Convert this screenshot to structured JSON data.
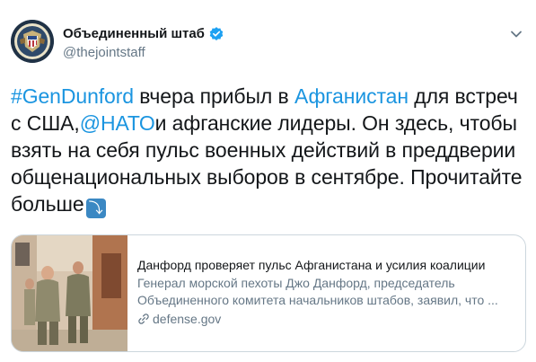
{
  "author": {
    "display_name": "Объединенный штаб",
    "handle": "@thejointstaff",
    "verified_icon": "verified-badge-icon"
  },
  "tweet": {
    "segments": [
      {
        "text": "#GenDunford",
        "type": "hashtag"
      },
      {
        "text": " вчера прибыл в ",
        "type": "text"
      },
      {
        "text": "Афганистан",
        "type": "hashtag"
      },
      {
        "text": " для встреч с США,",
        "type": "text"
      },
      {
        "text": "@НАТО",
        "type": "mention"
      },
      {
        "text": "и афганские лидеры. Он здесь, чтобы взять на себя пульс военных действий в преддверии общенациональных выборов в сентябре. Прочитайте больше",
        "type": "text"
      }
    ],
    "trailing_emoji": "⤵"
  },
  "card": {
    "title": "Данфорд проверяет пульс Афганистана и усилия коалиции",
    "description": "Генерал морской пехоты Джо Данфорд, председатель Объединенного комитета начальников штабов, заявил, что ...",
    "domain": "defense.gov"
  },
  "colors": {
    "link": "#1b95e0",
    "text": "#14171a",
    "secondary": "#657786",
    "border": "#ccd6dd"
  }
}
